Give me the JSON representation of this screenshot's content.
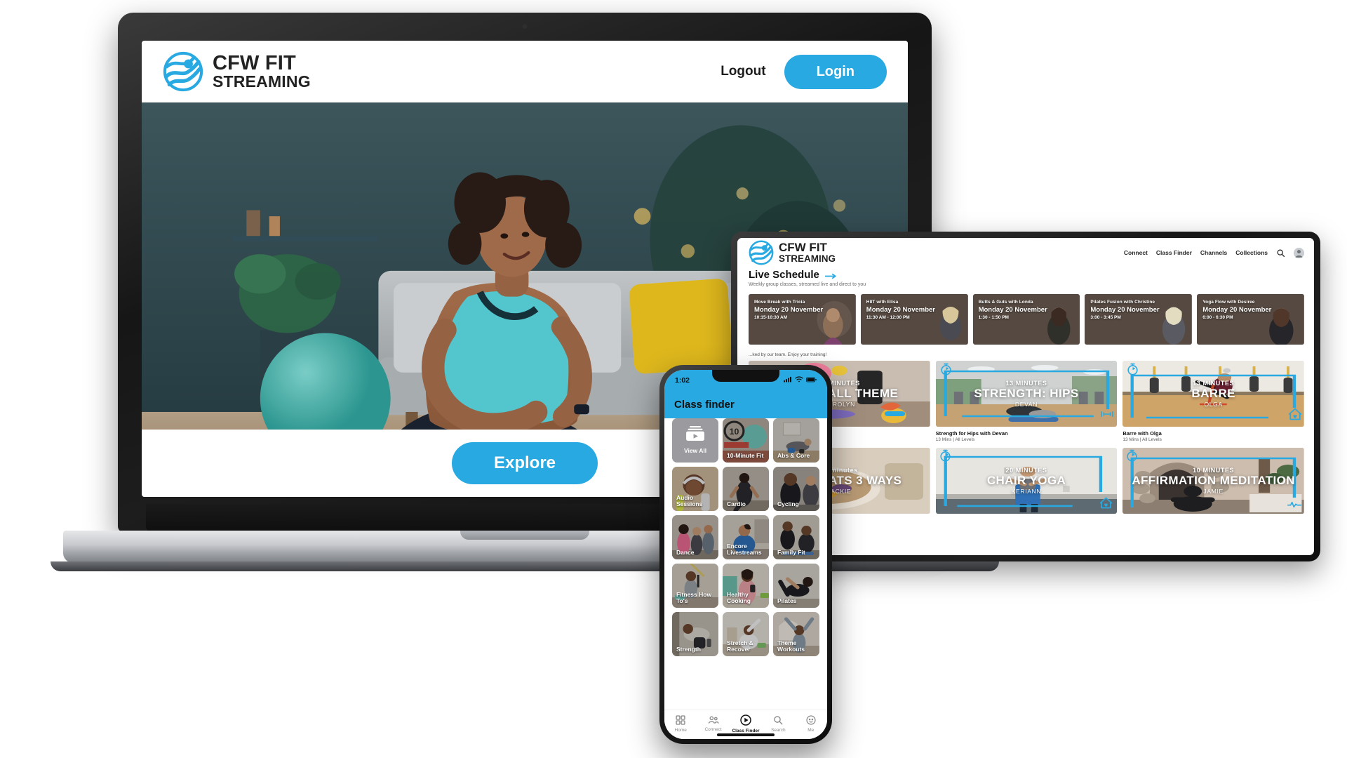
{
  "brand": {
    "line1": "CFW FIT",
    "line2": "STREAMING",
    "accent": "#29a9e1",
    "logo_icon": "cfw-wave-globe-logo"
  },
  "laptop": {
    "header": {
      "logout_label": "Logout",
      "login_label": "Login"
    },
    "hero": {
      "alt": "woman sitting cross-legged on floor in living room smiling",
      "explore_label": "Explore"
    }
  },
  "tablet": {
    "nav": {
      "items": [
        "Connect",
        "Class Finder",
        "Channels",
        "Collections"
      ],
      "search_icon": "search-icon",
      "avatar_icon": "user-avatar-icon"
    },
    "live_schedule": {
      "title": "Live Schedule",
      "arrow_icon": "arrow-right-icon",
      "subtitle": "Weekly group classes, streamed live and direct to you",
      "cards": [
        {
          "title": "Move Break with Tricia",
          "date": "Monday 20 November",
          "time": "10:15-10:30 AM"
        },
        {
          "title": "HIIT with Elisa",
          "date": "Monday 20 November",
          "time": "11:30 AM - 12:00 PM"
        },
        {
          "title": "Butts & Guts with Londa",
          "date": "Monday 20 November",
          "time": "1:30 - 1:50 PM"
        },
        {
          "title": "Pilates Fusion with Christine",
          "date": "Monday 20 November",
          "time": "3:00 - 3:45 PM"
        },
        {
          "title": "Yoga Flow with Desiree",
          "date": "Monday 20 November",
          "time": "6:00 - 6:30 PM"
        }
      ]
    },
    "on_demand": {
      "subtitle": "...ked by our team. Enjoy your training!",
      "videos": [
        {
          "minutes": "20 MINUTES",
          "title": "FLOW-FALL THEME",
          "instructor": "CAROLYN",
          "meta_title": "",
          "meta_sub": "",
          "icon": "stopwatch-icon"
        },
        {
          "minutes": "13 MINUTES",
          "title": "STRENGTH: HIPS",
          "instructor": "DEVAN",
          "meta_title": "Strength for Hips with Devan",
          "meta_sub": "13 Mins | All Levels",
          "icon": "stopwatch-icon"
        },
        {
          "minutes": "13 MINUTES",
          "title": "BARRE",
          "instructor": "OLGA",
          "meta_title": "Barre with Olga",
          "meta_sub": "13 Mins | All Levels",
          "icon": "stopwatch-icon"
        },
        {
          "minutes": "10 minutes",
          "title": "NIGHT OATS 3 WAYS",
          "instructor": "JACKIE",
          "meta_title": "",
          "meta_sub": "",
          "icon": "stopwatch-icon"
        },
        {
          "minutes": "20 MINUTES",
          "title": "CHAIR YOGA",
          "instructor": "KERIANN",
          "meta_title": "",
          "meta_sub": "",
          "icon": "stopwatch-icon"
        },
        {
          "minutes": "10 MINUTES",
          "title": "AFFIRMATION MEDITATION",
          "instructor": "JAMIE",
          "meta_title": "",
          "meta_sub": "",
          "icon": "stopwatch-icon"
        }
      ]
    }
  },
  "phone": {
    "status": {
      "time": "1:02",
      "signal_icon": "cellular-signal-icon",
      "wifi_icon": "wifi-icon",
      "battery_icon": "battery-icon"
    },
    "title": "Class finder",
    "tiles": [
      {
        "label": "View All",
        "icon": "video-library-icon"
      },
      {
        "label": "10-Minute Fit",
        "icon": ""
      },
      {
        "label": "Abs & Core",
        "icon": ""
      },
      {
        "label": "Audio Sessions",
        "icon": ""
      },
      {
        "label": "Cardio",
        "icon": ""
      },
      {
        "label": "Cycling",
        "icon": ""
      },
      {
        "label": "Dance",
        "icon": ""
      },
      {
        "label": "Encore Livestreams",
        "icon": ""
      },
      {
        "label": "Family Fit",
        "icon": ""
      },
      {
        "label": "Fitness How To's",
        "icon": ""
      },
      {
        "label": "Healthy Cooking",
        "icon": ""
      },
      {
        "label": "Pilates",
        "icon": ""
      },
      {
        "label": "Strength",
        "icon": ""
      },
      {
        "label": "Stretch & Recover",
        "icon": ""
      },
      {
        "label": "Theme Workouts",
        "icon": ""
      }
    ],
    "tabbar": [
      {
        "label": "Home",
        "icon": "grid-home-icon",
        "active": false
      },
      {
        "label": "Connect",
        "icon": "people-connect-icon",
        "active": false
      },
      {
        "label": "Class Finder",
        "icon": "play-circle-icon",
        "active": true
      },
      {
        "label": "Search",
        "icon": "search-icon",
        "active": false
      },
      {
        "label": "Me",
        "icon": "profile-icon",
        "active": false
      }
    ]
  }
}
